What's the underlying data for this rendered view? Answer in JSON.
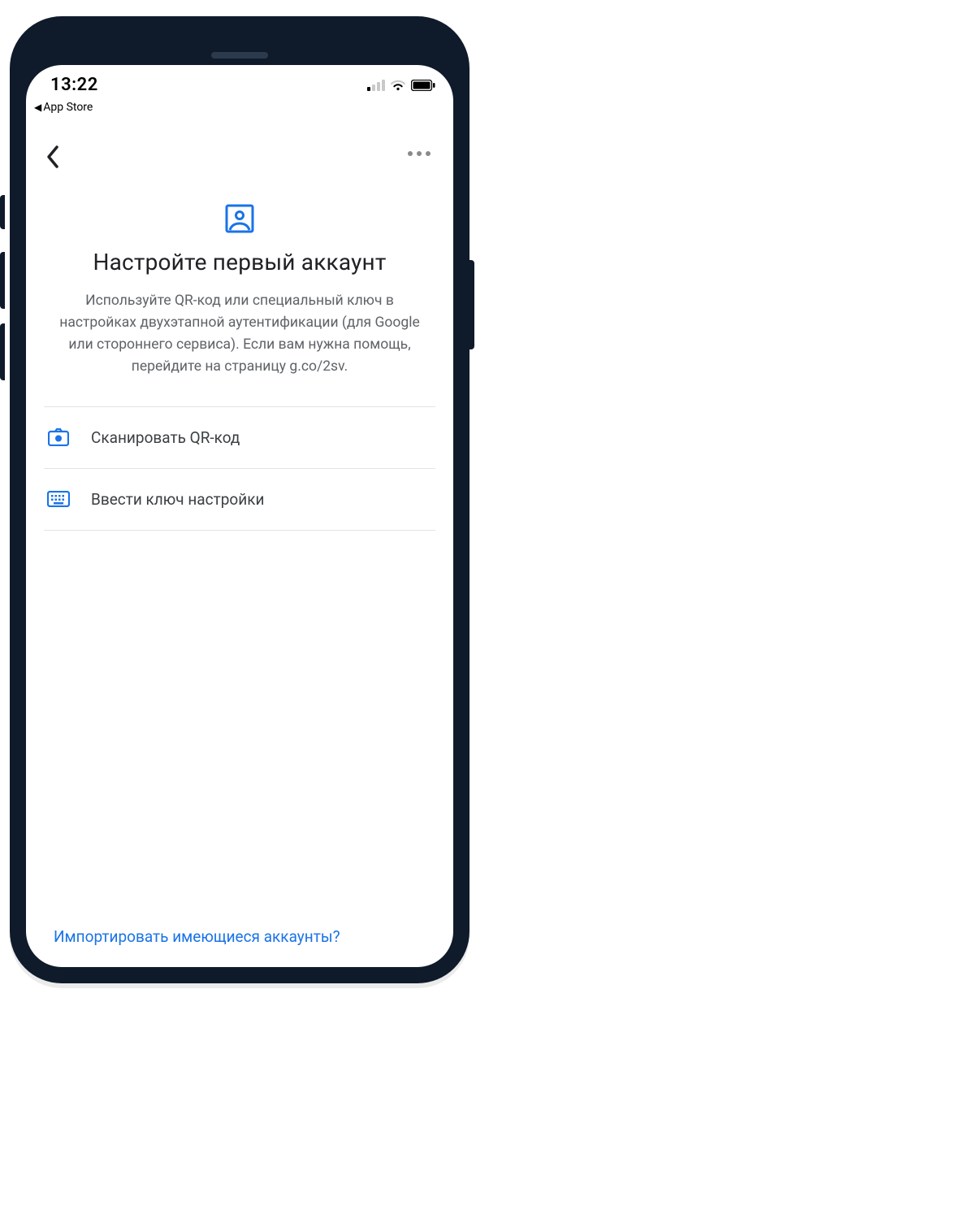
{
  "statusbar": {
    "time": "13:22",
    "back_to_app": "App Store"
  },
  "hero": {
    "title": "Настройте первый аккаунт",
    "body": "Используйте QR-код или специальный ключ в настройках двухэтапной аутентификации (для Google или стороннего сервиса). Если вам нужна помощь, перейдите на страницу g.co/2sv."
  },
  "options": [
    {
      "icon": "camera",
      "label": "Сканировать QR-код"
    },
    {
      "icon": "keyboard",
      "label": "Ввести ключ настройки"
    }
  ],
  "footer": {
    "import_link": "Импортировать имеющиеся аккаунты?"
  },
  "colors": {
    "accent": "#1a73e8",
    "text_primary": "#202124",
    "text_secondary": "#5f6368"
  }
}
